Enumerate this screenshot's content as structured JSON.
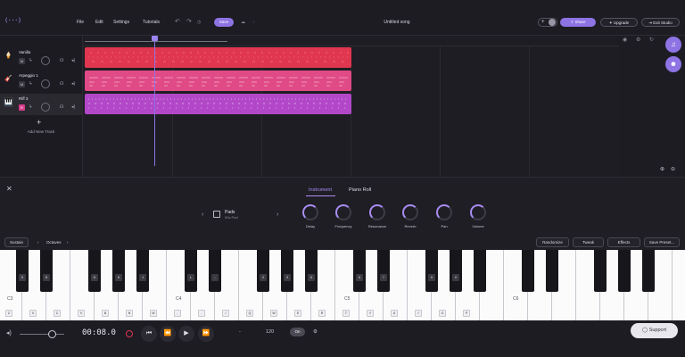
{
  "header": {
    "logo": "(···)",
    "menu": [
      "File",
      "Edit",
      "Settings",
      "Tutorials"
    ],
    "save_label": "Save",
    "song_title": "Untitled song",
    "share_label": "Share",
    "upgrade_label": "Upgrade",
    "exit_label": "Exit Studio"
  },
  "tracks": [
    {
      "name": "Vanilla",
      "icon": "🍦"
    },
    {
      "name": "Arpeggio 1",
      "icon": "🎸"
    },
    {
      "name": "Riff 3",
      "icon": "🎹"
    }
  ],
  "add_track_label": "Add New Track",
  "instrument_panel": {
    "tabs": [
      "Instrument",
      "Piano Roll"
    ],
    "preset": {
      "name": "Pads",
      "sub": "90s Pad"
    },
    "knobs": [
      "Delay",
      "Frequency",
      "Resonance",
      "Reverb",
      "Pan",
      "Volume"
    ],
    "sustain_label": "Sustain",
    "octave_label": "Octaves",
    "actions": [
      "Randomize",
      "Tweak",
      "Effects",
      "Save Preset..."
    ]
  },
  "keyboard": {
    "octave_marks": [
      "C3",
      "C4",
      "C5",
      "C6"
    ],
    "white_labels": [
      "Z",
      "X",
      "C",
      "V",
      "B",
      "N",
      "M",
      ",",
      ".",
      "/",
      "Q",
      "W",
      "E",
      "R",
      "T",
      "Y",
      "U",
      "I",
      "O",
      "P"
    ],
    "black_labels": [
      "S",
      "D",
      "G",
      "H",
      "J",
      "L",
      ";",
      "2",
      "3",
      "5",
      "6",
      "7",
      "9",
      "0"
    ]
  },
  "transport": {
    "time": "00:08.0",
    "tempo": "120",
    "metronome_label": "On",
    "support_label": "Support"
  },
  "colors": {
    "accent": "#8d73e3",
    "track_red": "#e0364f",
    "track_pink": "#e04a86",
    "track_violet": "#b248c8"
  }
}
